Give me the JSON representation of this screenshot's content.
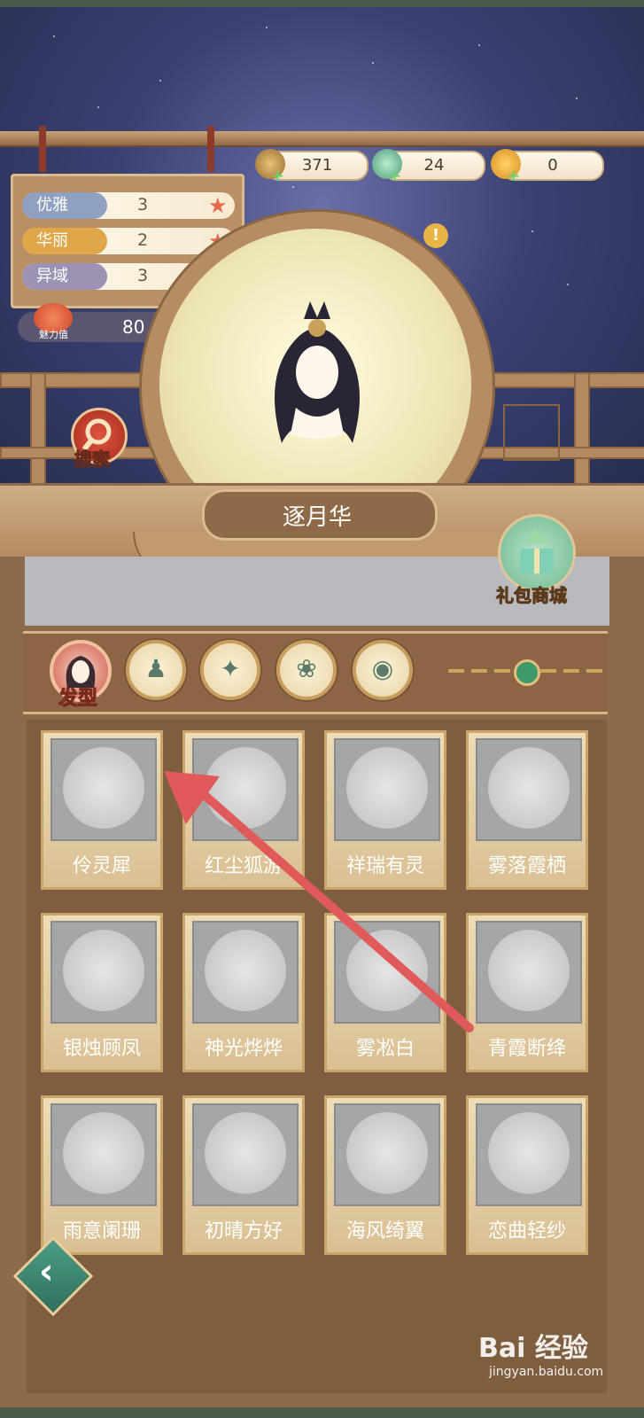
{
  "currencies": [
    {
      "icon": "coin-icon",
      "value": "371"
    },
    {
      "icon": "jade-icon",
      "value": "24"
    },
    {
      "icon": "gold-ingot-icon",
      "value": "0"
    }
  ],
  "attributes": [
    {
      "label": "优雅",
      "value": "3",
      "color": "#8fa0c0"
    },
    {
      "label": "华丽",
      "value": "2",
      "color": "#e0a74a"
    },
    {
      "label": "异域",
      "value": "3",
      "color": "#9c93b4"
    }
  ],
  "charm": {
    "label": "魅力值",
    "value": "80"
  },
  "search_label": "搜索",
  "item_name": "逐月华",
  "gift_shop_label": "礼包商城",
  "tabs": [
    {
      "label": "发型",
      "icon": "hair-icon",
      "active": true
    },
    {
      "icon": "dress-icon"
    },
    {
      "icon": "fan-icon"
    },
    {
      "icon": "necklace-icon"
    },
    {
      "icon": "mirror-icon"
    }
  ],
  "items": [
    "伶灵犀",
    "红尘狐游",
    "祥瑞有灵",
    "雾落霞栖",
    "银烛顾凤",
    "神光烨烨",
    "雾凇白",
    "青霞断绛",
    "雨意阑珊",
    "初晴方好",
    "海风绮翼",
    "恋曲轻纱"
  ],
  "watermark": {
    "main": "Bai 经验",
    "sub": "jingyan.baidu.com"
  }
}
